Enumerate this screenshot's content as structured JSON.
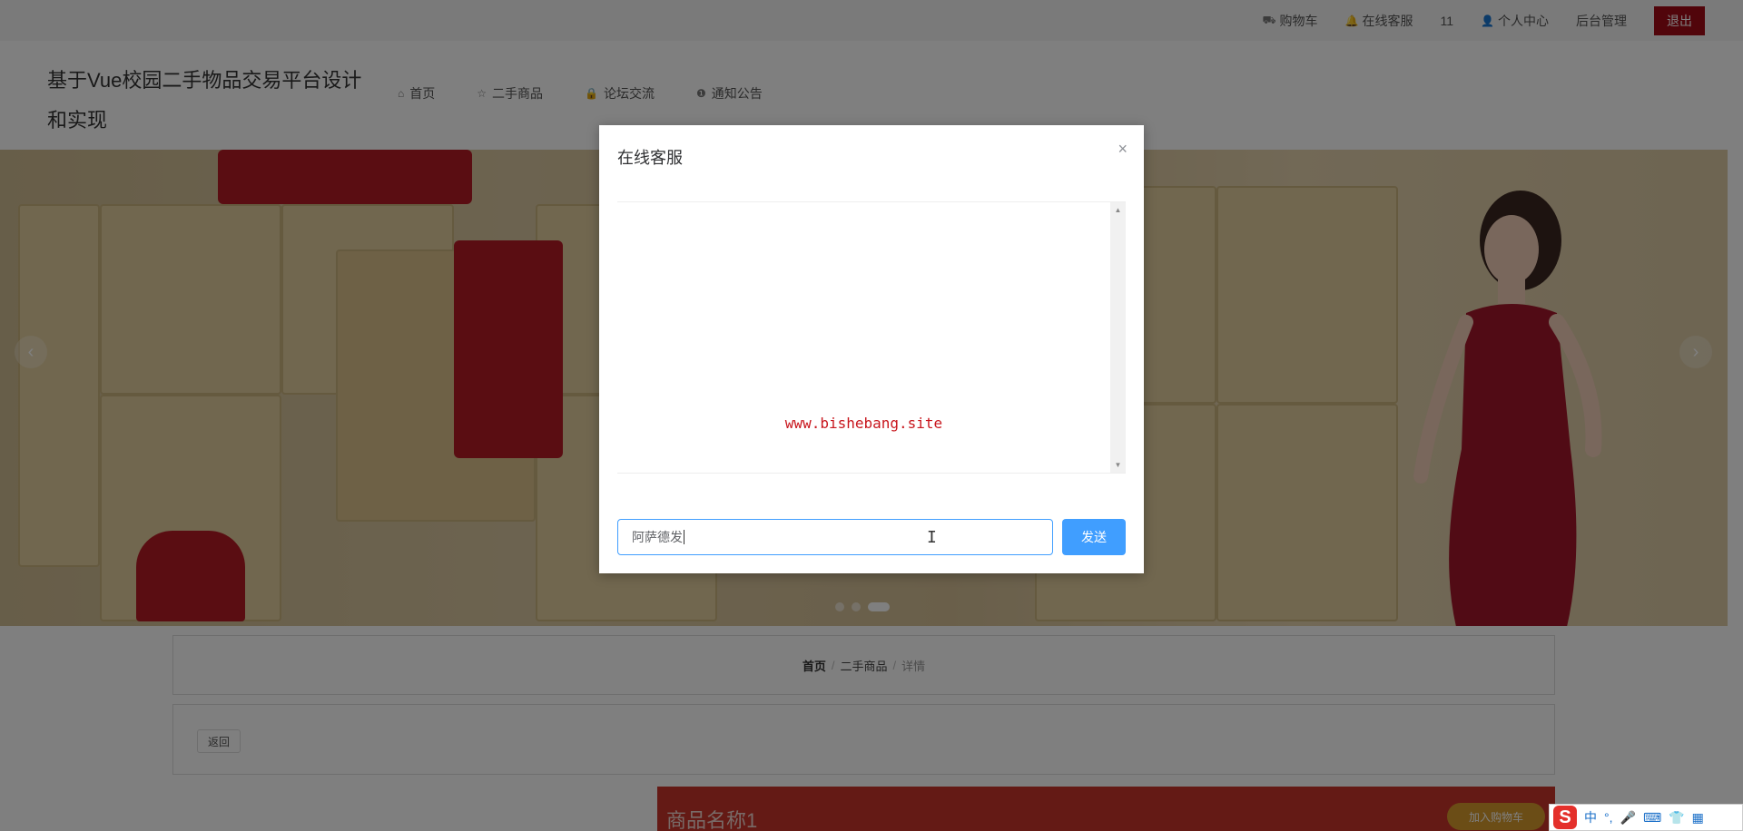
{
  "topbar": {
    "items": [
      {
        "icon": "cart-icon",
        "glyph": "⛟",
        "label": "购物车"
      },
      {
        "icon": "bell-icon",
        "glyph": "🔔",
        "label": "在线客服"
      },
      {
        "icon": "",
        "glyph": "",
        "label": "11"
      },
      {
        "icon": "user-icon",
        "glyph": "👤",
        "label": "个人中心"
      },
      {
        "icon": "",
        "glyph": "",
        "label": "后台管理"
      }
    ],
    "logout_label": "退出",
    "logout_color": "#a30b16"
  },
  "header": {
    "site_title": "基于Vue校园二手物品交易平台设计和实现",
    "nav": [
      {
        "icon": "home-icon",
        "glyph": "⌂",
        "label": "首页"
      },
      {
        "icon": "star-icon",
        "glyph": "☆",
        "label": "二手商品"
      },
      {
        "icon": "lock-icon",
        "glyph": "🔒",
        "label": "论坛交流"
      },
      {
        "icon": "info-icon",
        "glyph": "❶",
        "label": "通知公告"
      }
    ]
  },
  "banner": {
    "prev_glyph": "‹",
    "next_glyph": "›",
    "slide_count": 3,
    "active_slide": 3
  },
  "breadcrumb": {
    "items": [
      "首页",
      "二手商品",
      "详情"
    ],
    "separator": "/"
  },
  "back_button": "返回",
  "product": {
    "name": "商品名称1",
    "cart_pill": "加入购物车"
  },
  "dialog": {
    "title": "在线客服",
    "close_glyph": "×",
    "watermark": "www.bishebang.site",
    "input_value": "阿萨德发",
    "send_label": "发送",
    "accent_color": "#409eff"
  },
  "ime": {
    "logo": "S",
    "items": [
      "中",
      "°,",
      "🎤",
      "⌨",
      "👕",
      "▦"
    ]
  }
}
